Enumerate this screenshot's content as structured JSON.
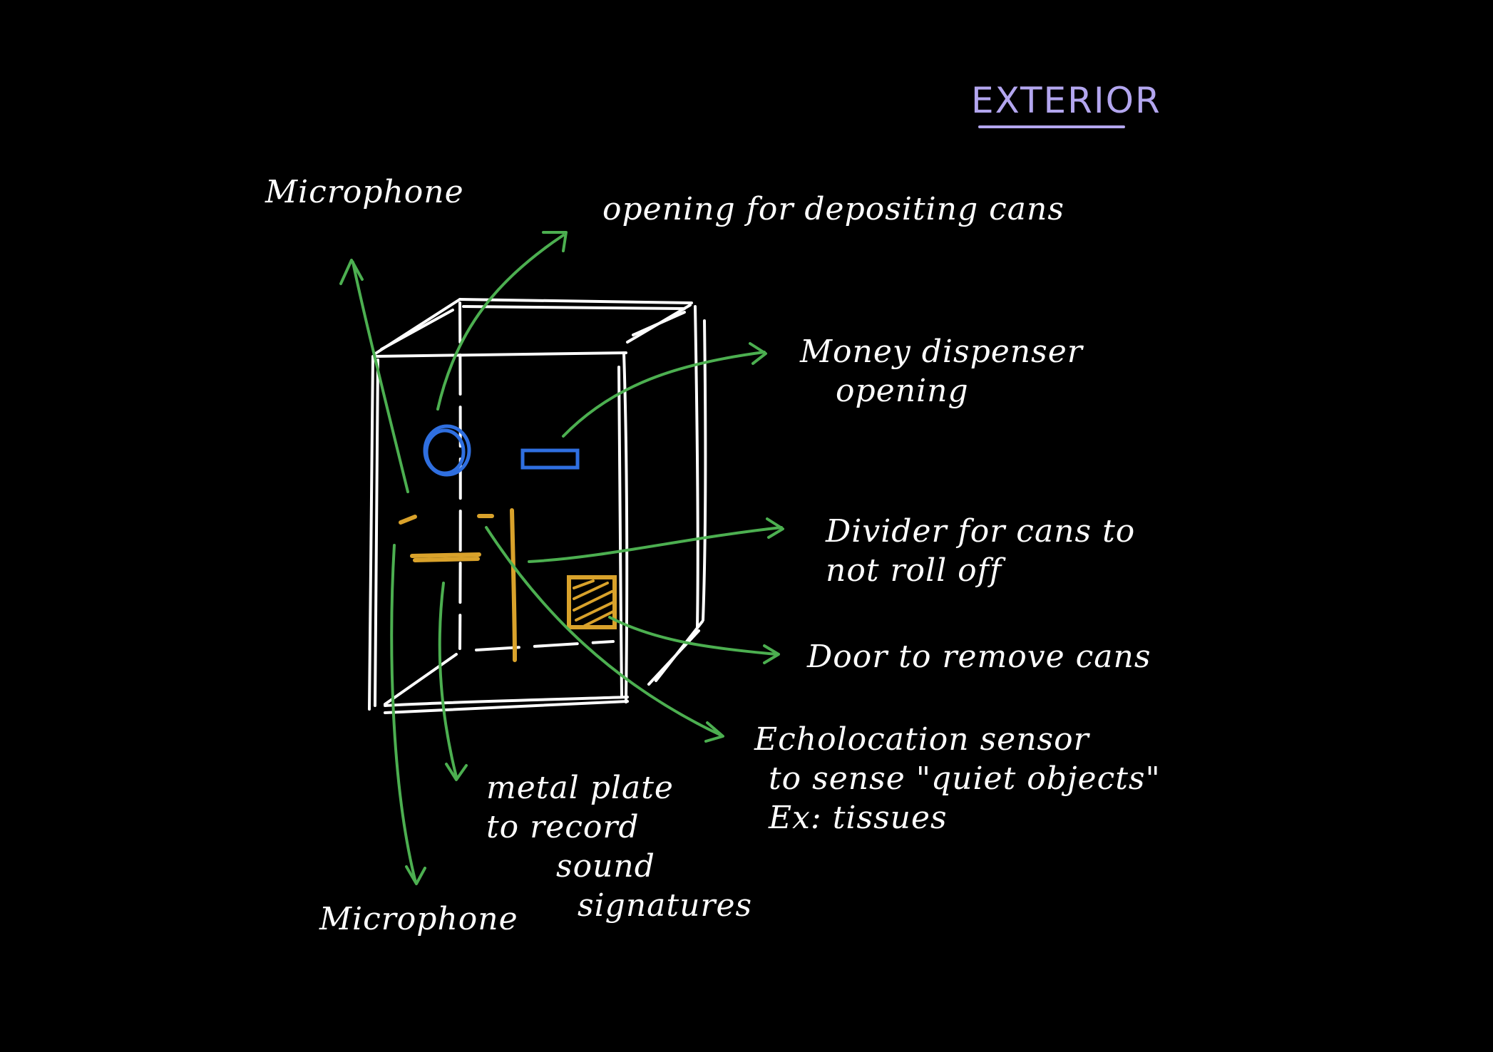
{
  "title": "EXTERIOR",
  "colors": {
    "background": "#000000",
    "ink": "#ffffff",
    "title": "#b3a6ef",
    "arrows": "#4caf50",
    "blue_parts": "#2f6fe0",
    "gold_parts": "#d9a22b"
  },
  "labels": {
    "microphone_top": "Microphone",
    "opening_cans": "opening for depositing cans",
    "money_dispenser": [
      "Money dispenser",
      "opening"
    ],
    "divider": [
      "Divider for cans to",
      "not roll off"
    ],
    "door": "Door to remove cans",
    "echolocation": [
      "Echolocation sensor",
      "to sense \"quiet objects\"",
      "Ex: tissues"
    ],
    "metal_plate": [
      "metal plate",
      "to record",
      "sound",
      "signatures"
    ],
    "microphone_bottom": "Microphone"
  }
}
